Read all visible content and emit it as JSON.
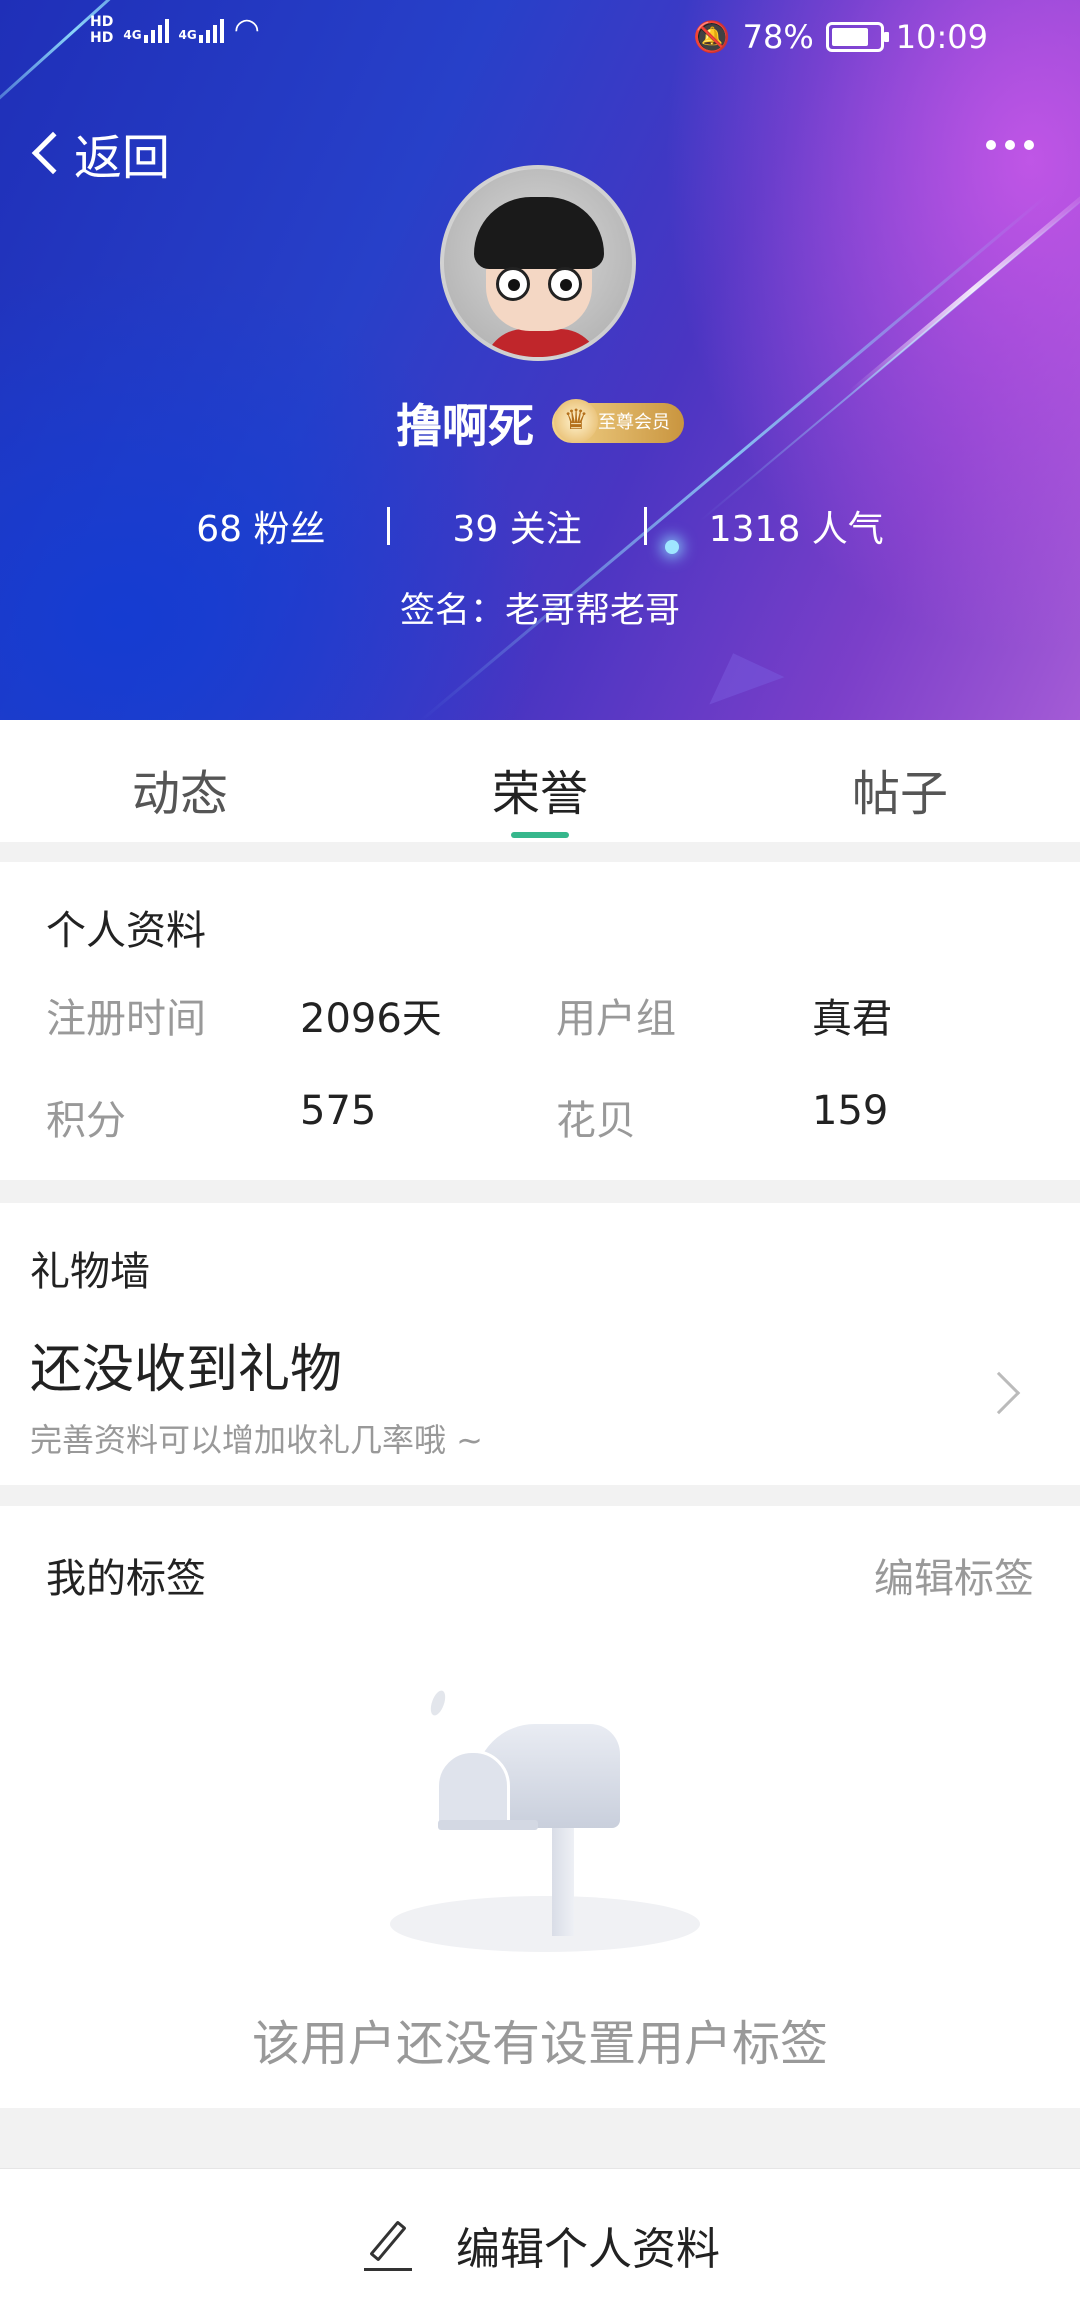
{
  "status_bar": {
    "left_indicators": [
      "HD",
      "HD",
      "4G",
      "4G"
    ],
    "battery_percent": "78%",
    "battery_level": 0.78,
    "time": "10:09"
  },
  "nav": {
    "back_label": "返回"
  },
  "profile_header": {
    "username": "撸啊死",
    "vip_badge": "至尊会员",
    "stats": [
      {
        "text": "68 粉丝"
      },
      {
        "text": "39 关注"
      },
      {
        "text": "1318 人气"
      }
    ],
    "signature": "签名：老哥帮老哥"
  },
  "tabs": [
    {
      "label": "动态",
      "active": false
    },
    {
      "label": "荣誉",
      "active": true
    },
    {
      "label": "帖子",
      "active": false
    }
  ],
  "personal_info": {
    "title": "个人资料",
    "rows": [
      [
        {
          "label": "注册时间",
          "value": "2096天"
        },
        {
          "label": "用户组",
          "value": "真君"
        }
      ],
      [
        {
          "label": "积分",
          "value": "575"
        },
        {
          "label": "花贝",
          "value": "159"
        }
      ]
    ]
  },
  "gift_wall": {
    "title": "礼物墙",
    "empty_title": "还没收到礼物",
    "hint": "完善资料可以增加收礼几率哦 ~"
  },
  "my_tags": {
    "title": "我的标签",
    "edit_label": "编辑标签",
    "empty_text": "该用户还没有设置用户标签"
  },
  "bottom": {
    "edit_profile_label": "编辑个人资料"
  },
  "colors": {
    "accent": "#36b78c",
    "muted_text": "#999999",
    "header_blue": "#2740c9",
    "header_purple": "#a45bd6"
  }
}
